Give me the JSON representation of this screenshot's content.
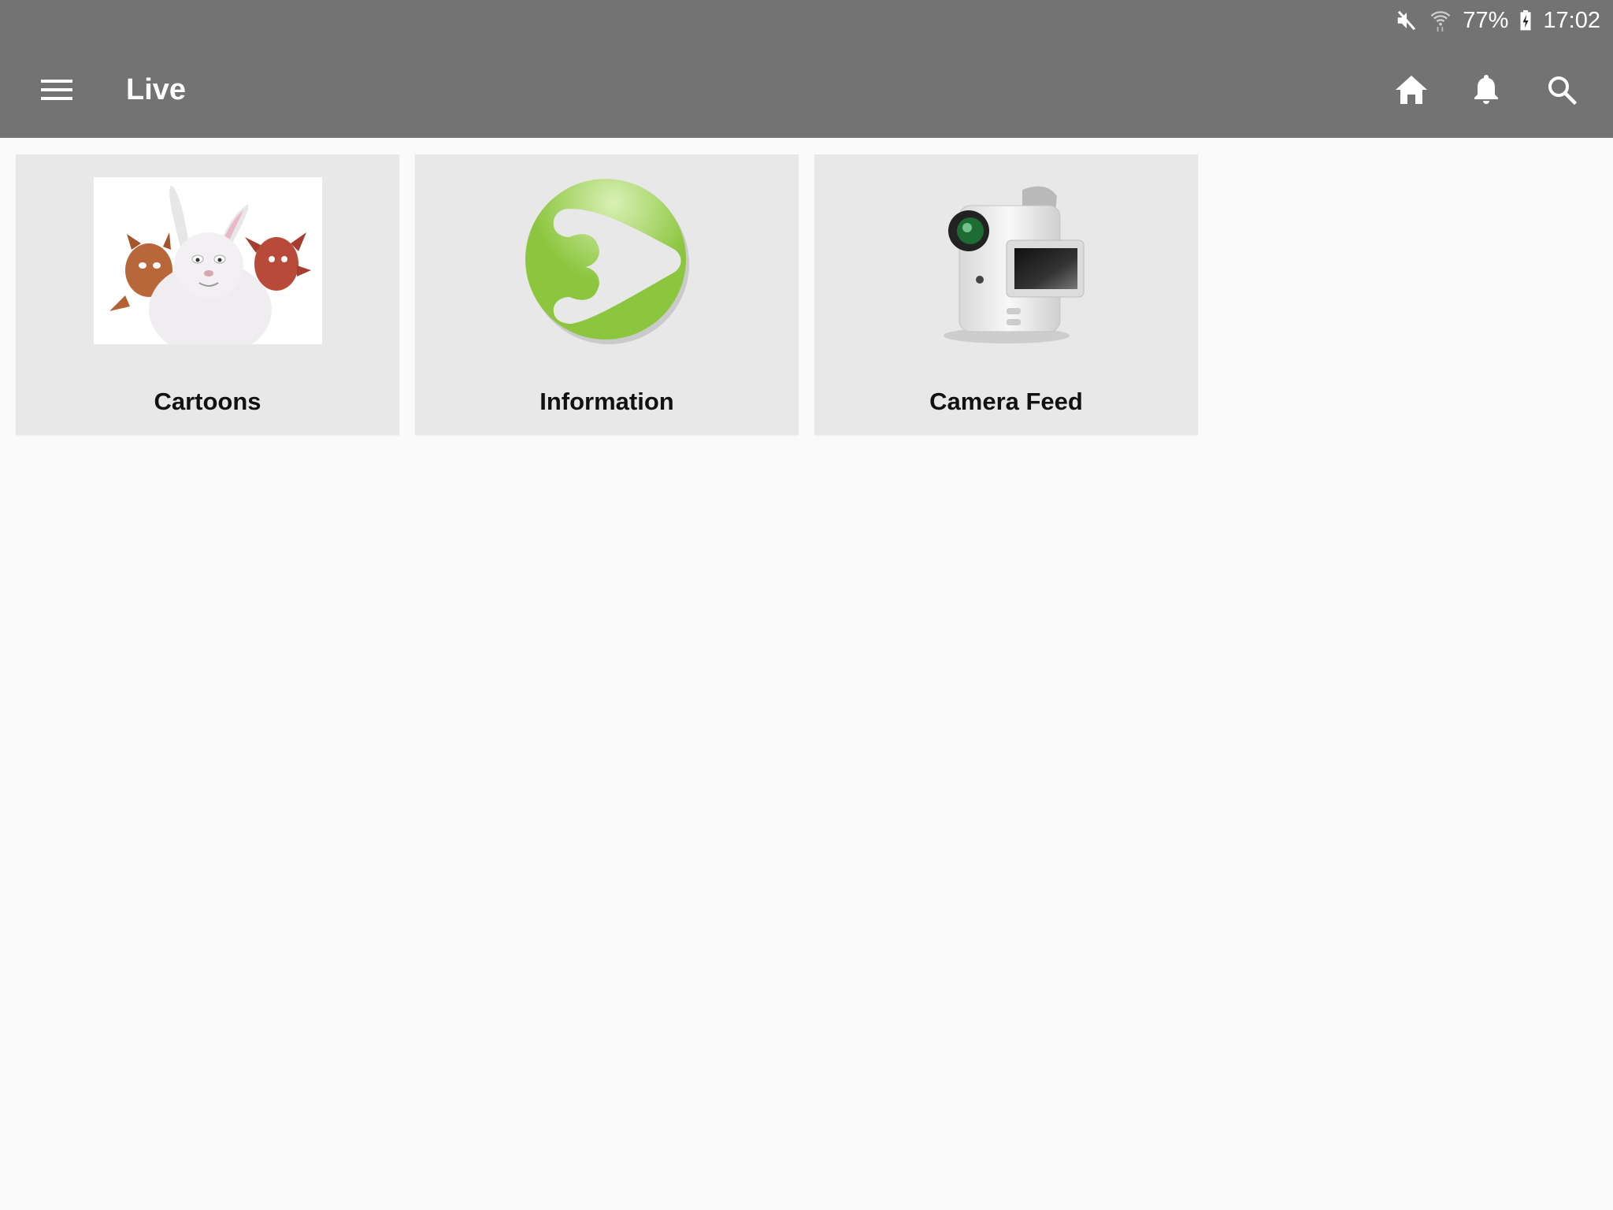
{
  "status_bar": {
    "icons": [
      "mute-icon",
      "wifi-icon",
      "battery-charging-icon"
    ],
    "battery_percent": "77%",
    "time": "17:02"
  },
  "toolbar": {
    "menu_icon": "hamburger-menu-icon",
    "title": "Live",
    "actions": [
      {
        "name": "home",
        "icon": "home-icon"
      },
      {
        "name": "notifications",
        "icon": "bell-icon"
      },
      {
        "name": "search",
        "icon": "search-icon"
      }
    ]
  },
  "colors": {
    "appbar": "#737373",
    "background": "#fafafa",
    "card": "#e8e8e8",
    "info_logo_green": "#8cc63f"
  },
  "categories": [
    {
      "label": "Cartoons",
      "image": "cartoon-characters-thumbnail"
    },
    {
      "label": "Information",
      "image": "green-play-logo"
    },
    {
      "label": "Camera Feed",
      "image": "camcorder-icon"
    }
  ]
}
